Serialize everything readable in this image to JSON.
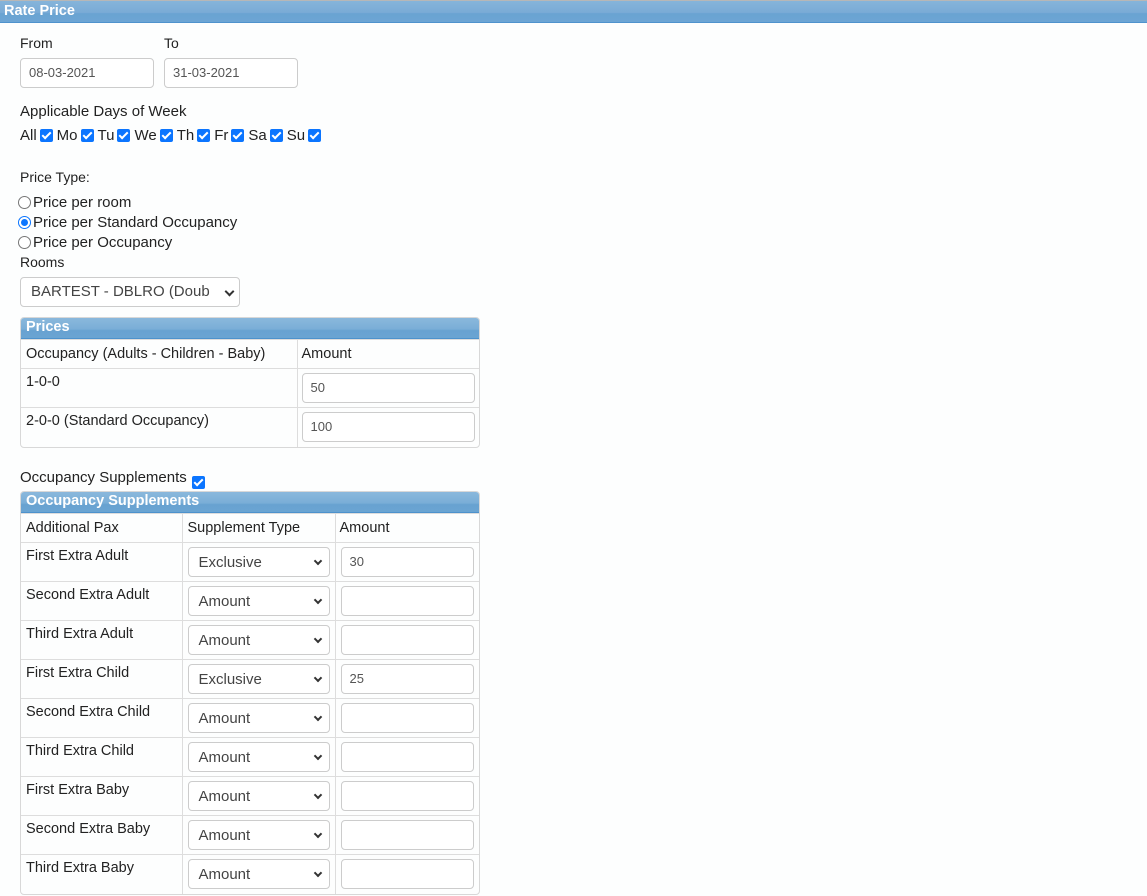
{
  "header": {
    "title": "Rate Price"
  },
  "dates": {
    "from_label": "From",
    "from_value": "08-03-2021",
    "to_label": "To",
    "to_value": "31-03-2021"
  },
  "days": {
    "title": "Applicable Days of Week",
    "items": [
      {
        "label": "All",
        "checked": true
      },
      {
        "label": "Mo",
        "checked": true
      },
      {
        "label": "Tu",
        "checked": true
      },
      {
        "label": "We",
        "checked": true
      },
      {
        "label": "Th",
        "checked": true
      },
      {
        "label": "Fr",
        "checked": true
      },
      {
        "label": "Sa",
        "checked": true
      },
      {
        "label": "Su",
        "checked": true
      }
    ]
  },
  "price_type": {
    "label": "Price Type:",
    "options": [
      {
        "label": "Price per room",
        "checked": false
      },
      {
        "label": "Price per Standard Occupancy",
        "checked": true
      },
      {
        "label": "Price per Occupancy",
        "checked": false
      }
    ]
  },
  "rooms": {
    "label": "Rooms",
    "selected": "BARTEST - DBLRO (Doub"
  },
  "prices": {
    "title": "Prices",
    "headers": [
      "Occupancy (Adults - Children - Baby)",
      "Amount"
    ],
    "rows": [
      {
        "occupancy": "1-0-0",
        "amount": "50"
      },
      {
        "occupancy": "2-0-0 (Standard Occupancy)",
        "amount": "100"
      }
    ]
  },
  "supplements": {
    "toggle_label": "Occupancy Supplements",
    "toggle_checked": true,
    "title": "Occupancy Supplements",
    "headers": [
      "Additional Pax",
      "Supplement Type",
      "Amount"
    ],
    "rows": [
      {
        "pax": "First Extra Adult",
        "type": "Exclusive",
        "amount": "30"
      },
      {
        "pax": "Second Extra Adult",
        "type": "Amount",
        "amount": ""
      },
      {
        "pax": "Third Extra Adult",
        "type": "Amount",
        "amount": ""
      },
      {
        "pax": "First Extra Child",
        "type": "Exclusive",
        "amount": "25"
      },
      {
        "pax": "Second Extra Child",
        "type": "Amount",
        "amount": ""
      },
      {
        "pax": "Third Extra Child",
        "type": "Amount",
        "amount": ""
      },
      {
        "pax": "First Extra Baby",
        "type": "Amount",
        "amount": ""
      },
      {
        "pax": "Second Extra Baby",
        "type": "Amount",
        "amount": ""
      },
      {
        "pax": "Third Extra Baby",
        "type": "Amount",
        "amount": ""
      }
    ]
  },
  "colors": {
    "header_blue": "#7aabd6",
    "checkbox_blue": "#0b75ff"
  }
}
